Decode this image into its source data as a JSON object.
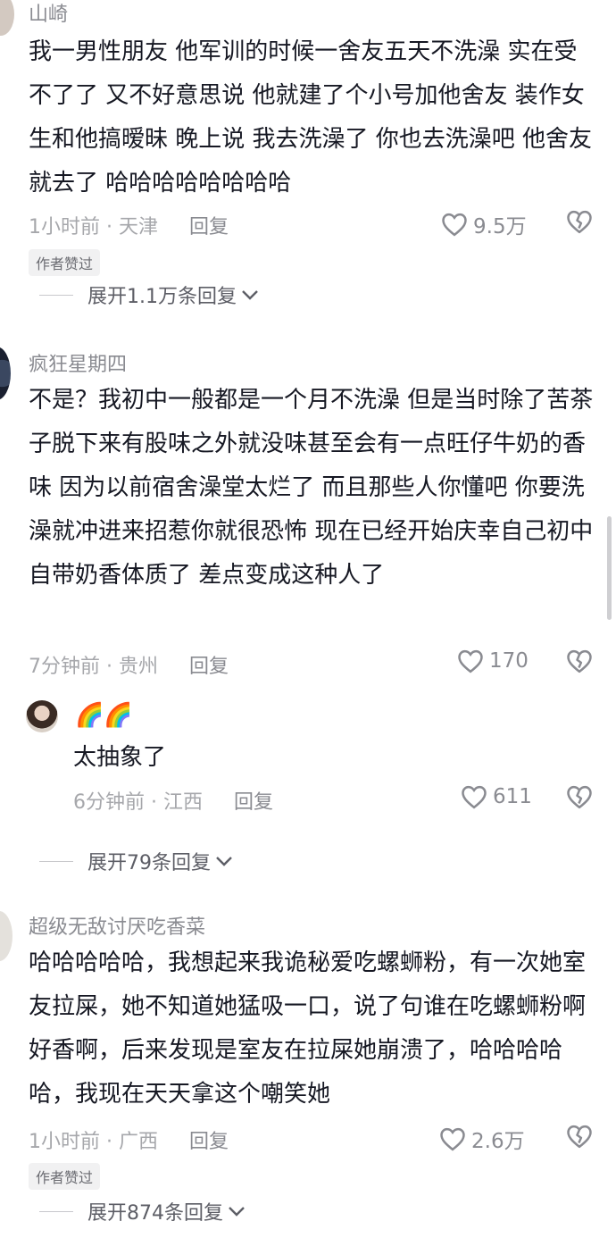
{
  "comments": [
    {
      "username": "山崎",
      "text": "我一男性朋友 他军训的时候一舍友五天不洗澡 实在受不了了 又不好意思说  他就建了个小号加他舍友 装作女生和他搞暧昧  晚上说 我去洗澡了 你也去洗澡吧 他舍友就去了 哈哈哈哈哈哈哈哈",
      "time": "1小时前",
      "location": "天津",
      "reply_label": "回复",
      "likes": "9.5万",
      "badge": "作者赞过",
      "expand_label": "展开1.1万条回复"
    },
    {
      "username": "疯狂星期四",
      "text": "不是？我初中一般都是一个月不洗澡 但是当时除了苦茶子脱下来有股味之外就没味甚至会有一点旺仔牛奶的香味 因为以前宿舍澡堂太烂了 而且那些人你懂吧 你要洗澡就冲进来招惹你就很恐怖 现在已经开始庆幸自己初中自带奶香体质了 差点变成这种人了",
      "time": "7分钟前",
      "location": "贵州",
      "reply_label": "回复",
      "likes": "170",
      "reply": {
        "username": "🌈🌈",
        "text": "太抽象了",
        "time": "6分钟前",
        "location": "江西",
        "reply_label": "回复",
        "likes": "611"
      },
      "expand_label": "展开79条回复"
    },
    {
      "username": "超级无敌讨厌吃香菜",
      "text": "哈哈哈哈哈，我想起来我诡秘爱吃螺蛳粉，有一次她室友拉屎，她不知道她猛吸一口，说了句谁在吃螺蛳粉啊好香啊，后来发现是室友在拉屎她崩溃了，哈哈哈哈哈，我现在天天拿这个嘲笑她",
      "time": "1小时前",
      "location": "广西",
      "reply_label": "回复",
      "likes": "2.6万",
      "badge": "作者赞过",
      "expand_label": "展开874条回复"
    }
  ],
  "meta_separator": "·",
  "icons": {
    "like": "heart-outline-icon",
    "dislike": "broken-heart-icon",
    "expand": "chevron-down-icon"
  },
  "colors": {
    "text": "#161823",
    "secondary": "#8a8b91",
    "badge_bg": "#f1f1f2"
  }
}
